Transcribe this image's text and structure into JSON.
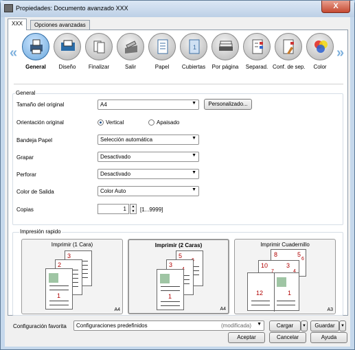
{
  "window": {
    "title": "Propiedades: Documento avanzado XXX",
    "close": "X"
  },
  "tabs": [
    "XXX",
    "Opciones avanzadas"
  ],
  "iconbar": {
    "left_arrow": "«",
    "right_arrow": "»",
    "items": [
      {
        "label": "General",
        "icon": "printer-icon"
      },
      {
        "label": "Diseño",
        "icon": "layout-icon"
      },
      {
        "label": "Finalizar",
        "icon": "finishing-icon"
      },
      {
        "label": "Salir",
        "icon": "output-tray-icon"
      },
      {
        "label": "Papel",
        "icon": "paper-icon"
      },
      {
        "label": "Cubiertas",
        "icon": "cover-icon"
      },
      {
        "label": "Por página",
        "icon": "per-page-icon"
      },
      {
        "label": "Separad.",
        "icon": "separator-icon"
      },
      {
        "label": "Conf. de sep.",
        "icon": "separator-settings-icon"
      },
      {
        "label": "Color",
        "icon": "color-icon"
      }
    ]
  },
  "general": {
    "group_title": "General",
    "paper_size_label": "Tamaño del original",
    "paper_size_value": "A4",
    "custom_button": "Personalizado...",
    "orientation_label": "Orientación original",
    "portrait": "Vertical",
    "landscape": "Apaisado",
    "tray_label": "Bandeja Papel",
    "tray_value": "Selección automática",
    "staple_label": "Grapar",
    "staple_value": "Desactivado",
    "punch_label": "Perforar",
    "punch_value": "Desactivado",
    "color_label": "Color de Salida",
    "color_value": "Color Auto",
    "copies_label": "Copias",
    "copies_value": "1",
    "copies_range": "[1...9999]"
  },
  "quick": {
    "title": "Impresión rapido",
    "presets": [
      {
        "label": "Imprimir (1 Cara)",
        "size": "A4",
        "pages": [
          "3",
          "2",
          "1"
        ]
      },
      {
        "label": "Imprimir (2 Caras)",
        "size": "A4",
        "pages": [
          "5",
          "6",
          "3",
          "4",
          "1"
        ]
      },
      {
        "label": "Imprimir Cuadernillo",
        "size": "A3",
        "pages": [
          "8",
          "5",
          "6",
          "10",
          "3",
          "4",
          "7",
          "12",
          "1"
        ]
      }
    ]
  },
  "favorites": {
    "label": "Configuración favorita",
    "value": "Configuraciones predefinidos",
    "modified": "(modificada)",
    "load": "Cargar",
    "save": "Guardar"
  },
  "footer": {
    "ok": "Aceptar",
    "cancel": "Cancelar",
    "help": "Ayuda"
  }
}
